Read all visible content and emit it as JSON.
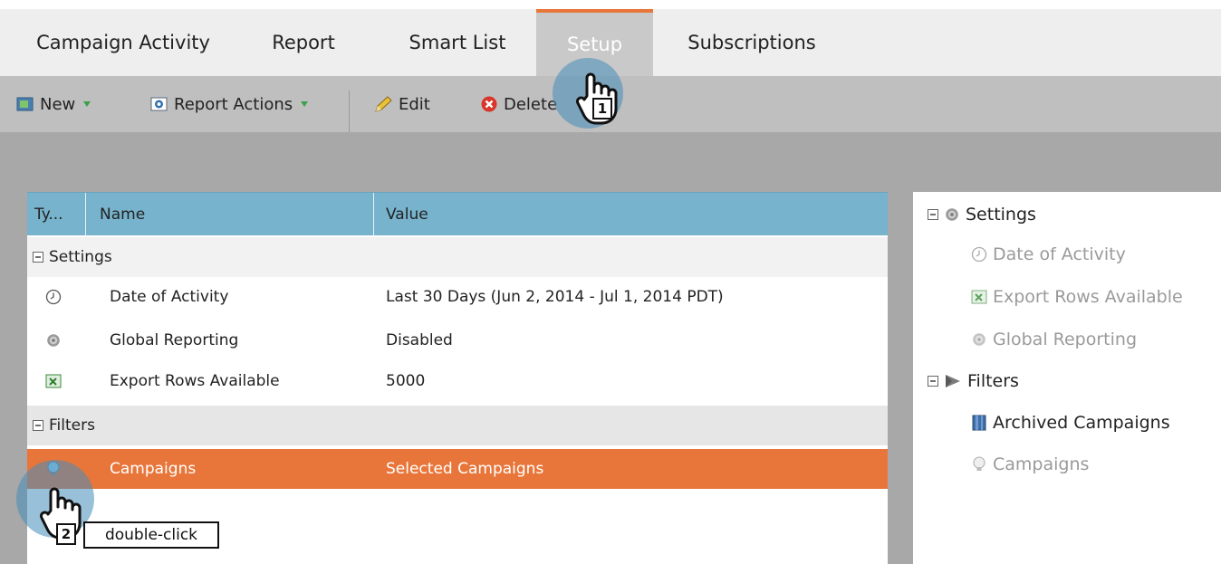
{
  "tabs": [
    {
      "label": "Campaign Activity",
      "active": false
    },
    {
      "label": "Report",
      "active": false
    },
    {
      "label": "Smart List",
      "active": false
    },
    {
      "label": "Setup",
      "active": true
    },
    {
      "label": "Subscriptions",
      "active": false
    }
  ],
  "toolbar": {
    "new_label": "New",
    "report_actions_label": "Report Actions",
    "edit_label": "Edit",
    "delete_label": "Delete"
  },
  "grid": {
    "columns": [
      "Ty...",
      "Name",
      "Value"
    ],
    "settings_section": "Settings",
    "settings_rows": [
      {
        "icon": "clock-icon",
        "name": "Date of Activity",
        "value": "Last 30 Days (Jun 2, 2014 - Jul 1, 2014 PDT)"
      },
      {
        "icon": "gear-icon",
        "name": "Global Reporting",
        "value": "Disabled"
      },
      {
        "icon": "excel-icon",
        "name": "Export Rows Available",
        "value": "5000"
      }
    ],
    "filters_section": "Filters",
    "filter_rows": [
      {
        "icon": "lightbulb-icon",
        "name": "Campaigns",
        "value": "Selected Campaigns",
        "selected": true
      }
    ]
  },
  "panel": {
    "settings_label": "Settings",
    "settings_items": [
      "Date of Activity",
      "Export Rows Available",
      "Global Reporting"
    ],
    "filters_label": "Filters",
    "filter_items": [
      {
        "label": "Archived Campaigns",
        "dim": false
      },
      {
        "label": "Campaigns",
        "dim": true
      }
    ]
  },
  "annotations": {
    "step1": "1",
    "step2": "2",
    "tooltip": "double-click"
  },
  "colors": {
    "accent": "#e8763a",
    "grid_header": "#77b3cc",
    "highlight": "#468cb9"
  }
}
